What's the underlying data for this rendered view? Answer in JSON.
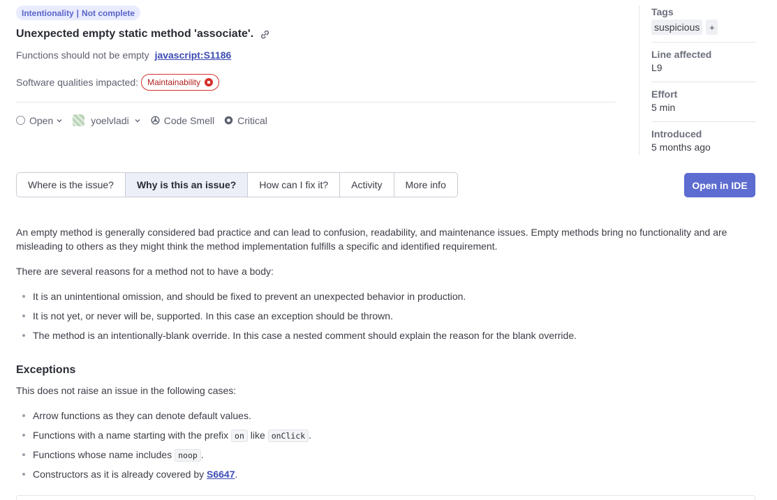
{
  "header": {
    "attribute_badge": {
      "category": "Intentionality",
      "status": "Not complete"
    },
    "title": "Unexpected empty static method 'associate'.",
    "rule_description": "Functions should not be empty",
    "rule_key": "javascript:S1186",
    "qualities_label": "Software qualities impacted:",
    "quality_pill": "Maintainability"
  },
  "meta": {
    "status": "Open",
    "assignee": "yoelvladi",
    "type": "Code Smell",
    "severity": "Critical"
  },
  "sidebar": {
    "tags_label": "Tags",
    "tags": [
      "suspicious"
    ],
    "tag_add": "+",
    "line_label": "Line affected",
    "line_value": "L9",
    "effort_label": "Effort",
    "effort_value": "5 min",
    "introduced_label": "Introduced",
    "introduced_value": "5 months ago"
  },
  "tabs": [
    {
      "label": "Where is the issue?",
      "active": false
    },
    {
      "label": "Why is this an issue?",
      "active": true
    },
    {
      "label": "How can I fix it?",
      "active": false
    },
    {
      "label": "Activity",
      "active": false
    },
    {
      "label": "More info",
      "active": false
    }
  ],
  "open_in_ide": "Open in IDE",
  "content": {
    "intro": "An empty method is generally considered bad practice and can lead to confusion, readability, and maintenance issues. Empty methods bring no functionality and are misleading to others as they might think the method implementation fulfills a specific and identified requirement.",
    "reasons_intro": "There are several reasons for a method not to have a body:",
    "reasons": [
      "It is an unintentional omission, and should be fixed to prevent an unexpected behavior in production.",
      "It is not yet, or never will be, supported. In this case an exception should be thrown.",
      "The method is an intentionally-blank override. In this case a nested comment should explain the reason for the blank override."
    ],
    "exceptions_heading": "Exceptions",
    "exceptions_intro": "This does not raise an issue in the following cases:",
    "exception_1": "Arrow functions as they can denote default values.",
    "exception_2_pre": "Functions with a name starting with the prefix",
    "exception_2_code1": "on",
    "exception_2_mid": "like",
    "exception_2_code2": "onClick",
    "exception_2_post": ".",
    "exception_3_pre": "Functions whose name includes",
    "exception_3_code": "noop",
    "exception_3_post": ".",
    "exception_4_pre": "Constructors as it is already covered by",
    "exception_4_link": "S6647",
    "exception_4_post": "."
  },
  "colors": {
    "accent": "#5d6cd0",
    "severity_red": "#d6302c",
    "badge_bg": "#e9ebff"
  }
}
